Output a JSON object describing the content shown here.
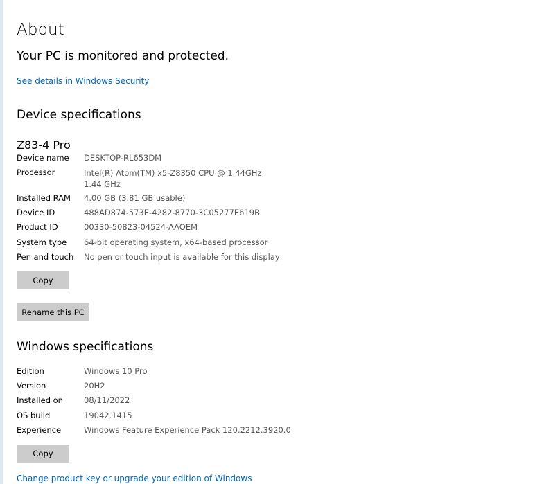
{
  "page": {
    "title": "About",
    "protection_message": "Your PC is monitored and protected.",
    "security_link": "See details in Windows Security"
  },
  "device": {
    "heading": "Device specifications",
    "model": "Z83-4 Pro",
    "rows": [
      {
        "label": "Device name",
        "value": "DESKTOP-RL653DM"
      },
      {
        "label": "Processor",
        "value": "Intel(R) Atom(TM) x5-Z8350  CPU @ 1.44GHz   1.44 GHz"
      },
      {
        "label": "Installed RAM",
        "value": "4.00 GB (3.81 GB usable)"
      },
      {
        "label": "Device ID",
        "value": "488AD874-573E-4282-8770-3C05277E619B"
      },
      {
        "label": "Product ID",
        "value": "00330-50823-04524-AAOEM"
      },
      {
        "label": "System type",
        "value": "64-bit operating system, x64-based processor"
      },
      {
        "label": "Pen and touch",
        "value": "No pen or touch input is available for this display"
      }
    ],
    "copy_label": "Copy",
    "rename_label": "Rename this PC"
  },
  "windows": {
    "heading": "Windows specifications",
    "rows": [
      {
        "label": "Edition",
        "value": "Windows 10 Pro"
      },
      {
        "label": "Version",
        "value": "20H2"
      },
      {
        "label": "Installed on",
        "value": "08/11/2022"
      },
      {
        "label": "OS build",
        "value": "19042.1415"
      },
      {
        "label": "Experience",
        "value": "Windows Feature Experience Pack 120.2212.3920.0"
      }
    ],
    "copy_label": "Copy",
    "change_link": "Change product key or upgrade your edition of Windows"
  },
  "colors": {
    "link": "#0067b8",
    "button_bg": "#cccccc",
    "value_text": "#555555"
  }
}
